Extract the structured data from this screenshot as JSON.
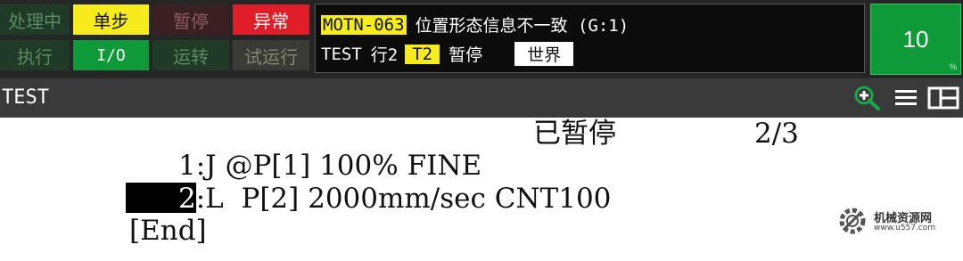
{
  "status_panel": {
    "row1": [
      "处理中",
      "单步",
      "暂停",
      "异常"
    ],
    "row2": [
      "执行",
      "I/O",
      "运转",
      "试运行"
    ]
  },
  "alarm": {
    "code": "MOTN-063",
    "message": "位置形态信息不一致 (G:1)",
    "program": "TEST",
    "line": "行2",
    "tool": "T2",
    "state": "暂停",
    "frame": "世界"
  },
  "override": {
    "value": "10",
    "unit_mark": "%"
  },
  "title_bar": {
    "title": "TEST",
    "icons": [
      "zoom-in-icon",
      "menu-icon",
      "split-view-icon"
    ]
  },
  "editor": {
    "state": "已暂停",
    "line_counter": "2/3",
    "lines": [
      {
        "num": "1",
        "text": ":J @P[1] 100% FINE"
      },
      {
        "num": "2",
        "text": ":L  P[2] 2000mm/sec CNT100"
      }
    ],
    "end_marker": "[End]"
  },
  "watermark": {
    "title": "机械资源网",
    "url": "www.u557.com"
  },
  "colors": {
    "status_yellow": "#f6ec1b",
    "status_green": "#0f9a3a",
    "status_red": "#e01e2a",
    "titlebar": "#3a3a3a",
    "panel_bg": "#262626",
    "icon_green": "#17a84a"
  }
}
